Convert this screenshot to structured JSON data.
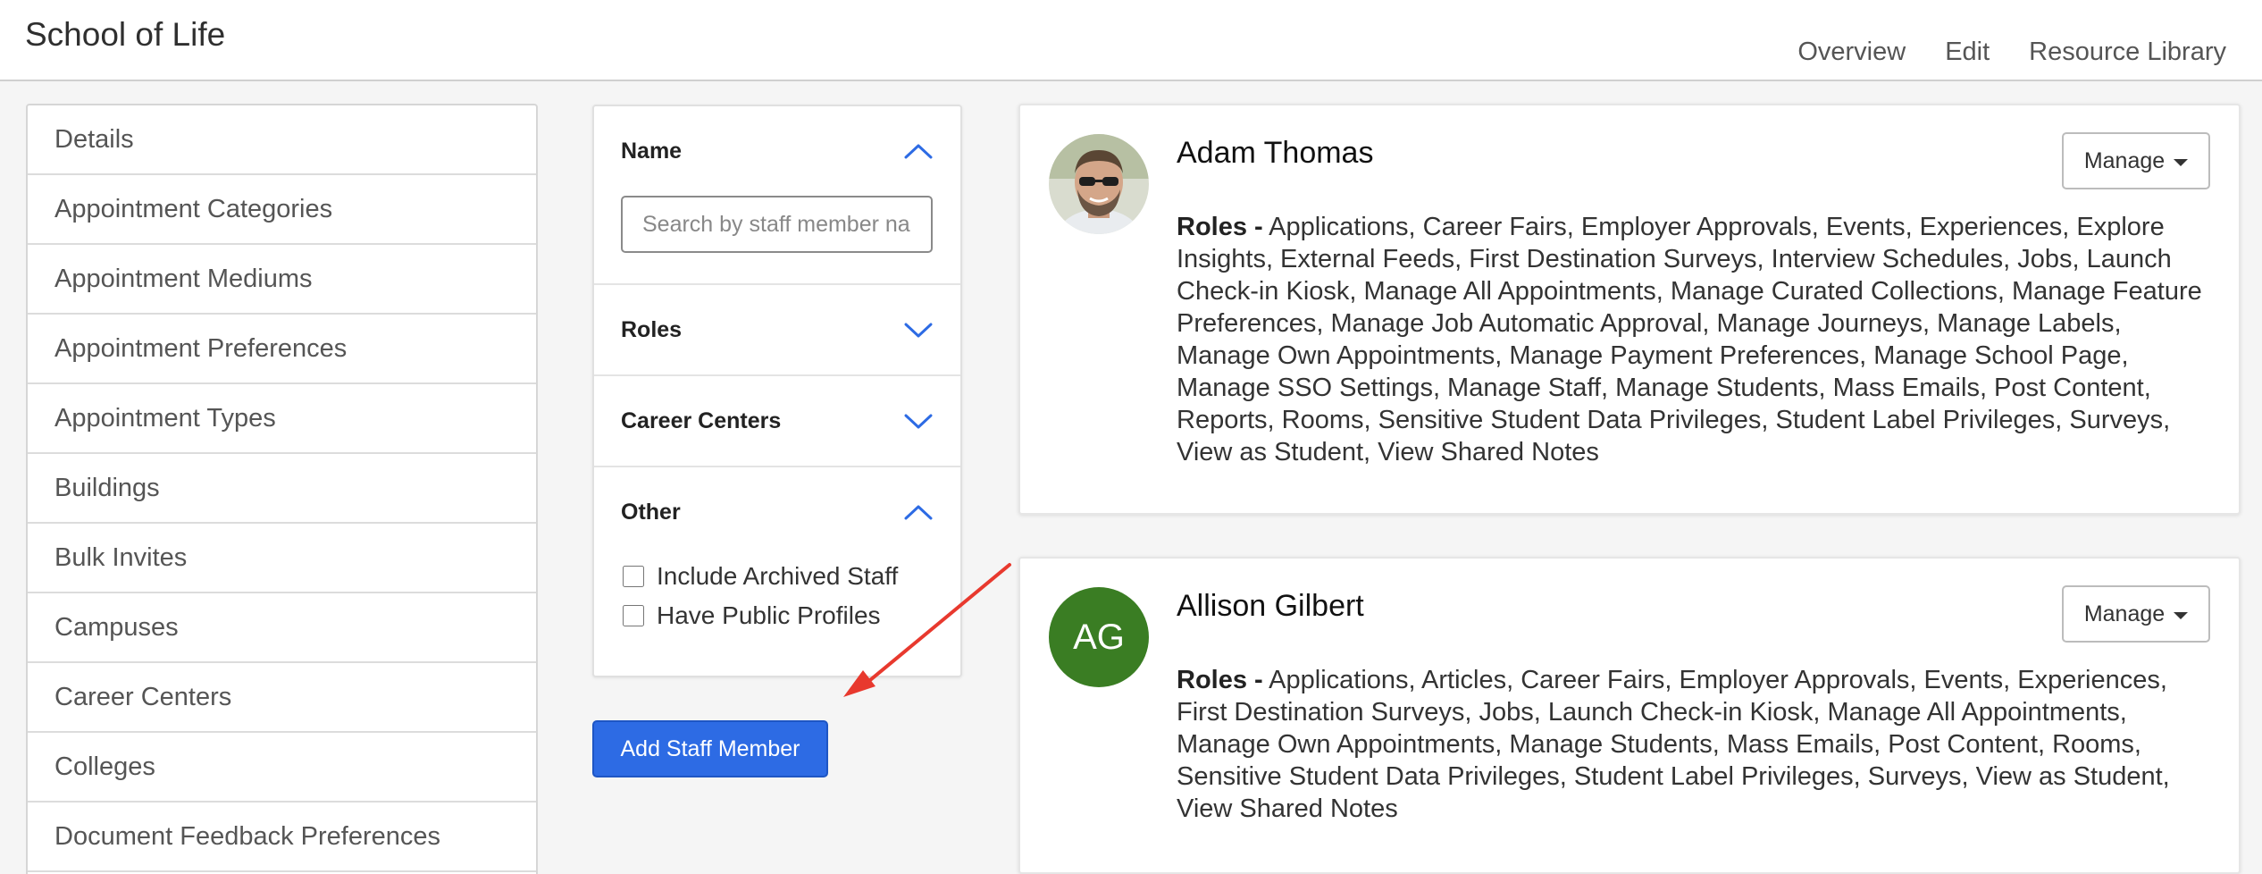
{
  "header": {
    "title": "School of Life",
    "nav": [
      "Overview",
      "Edit",
      "Resource Library"
    ]
  },
  "sidebar": {
    "items": [
      {
        "label": "Details"
      },
      {
        "label": "Appointment Categories"
      },
      {
        "label": "Appointment Mediums"
      },
      {
        "label": "Appointment Preferences"
      },
      {
        "label": "Appointment Types"
      },
      {
        "label": "Buildings"
      },
      {
        "label": "Bulk Invites"
      },
      {
        "label": "Campuses"
      },
      {
        "label": "Career Centers"
      },
      {
        "label": "Colleges"
      },
      {
        "label": "Document Feedback Preferences"
      }
    ]
  },
  "filters": {
    "name": {
      "label": "Name",
      "expanded": true,
      "placeholder": "Search by staff member name",
      "value": ""
    },
    "roles": {
      "label": "Roles",
      "expanded": false
    },
    "career_centers": {
      "label": "Career Centers",
      "expanded": false
    },
    "other": {
      "label": "Other",
      "expanded": true,
      "options": [
        {
          "label": "Include Archived Staff",
          "checked": false
        },
        {
          "label": "Have Public Profiles",
          "checked": false
        }
      ]
    }
  },
  "add_button": {
    "label": "Add Staff Member"
  },
  "staff": [
    {
      "name": "Adam Thomas",
      "roles_label": "Roles -",
      "roles": "Applications, Career Fairs, Employer Approvals, Events, Experiences, Explore Insights, External Feeds, First Destination Surveys, Interview Schedules, Jobs, Launch Check-in Kiosk, Manage All Appointments, Manage Curated Collections, Manage Feature Preferences, Manage Job Automatic Approval, Manage Journeys, Manage Labels, Manage Own Appointments, Manage Payment Preferences, Manage School Page, Manage SSO Settings, Manage Staff, Manage Students, Mass Emails, Post Content, Reports, Rooms, Sensitive Student Data Privileges, Student Label Privileges, Surveys, View as Student, View Shared Notes",
      "manage_label": "Manage"
    },
    {
      "name": "Allison Gilbert",
      "initials": "AG",
      "avatar_color": "#3a7d23",
      "roles_label": "Roles -",
      "roles": "Applications, Articles, Career Fairs, Employer Approvals, Events, Experiences, First Destination Surveys, Jobs, Launch Check-in Kiosk, Manage All Appointments, Manage Own Appointments, Manage Students, Mass Emails, Post Content, Rooms, Sensitive Student Data Privileges, Student Label Privileges, Surveys, View as Student, View Shared Notes",
      "manage_label": "Manage"
    }
  ],
  "colors": {
    "accent": "#2d6be4",
    "annotation_arrow": "#e8392e"
  }
}
